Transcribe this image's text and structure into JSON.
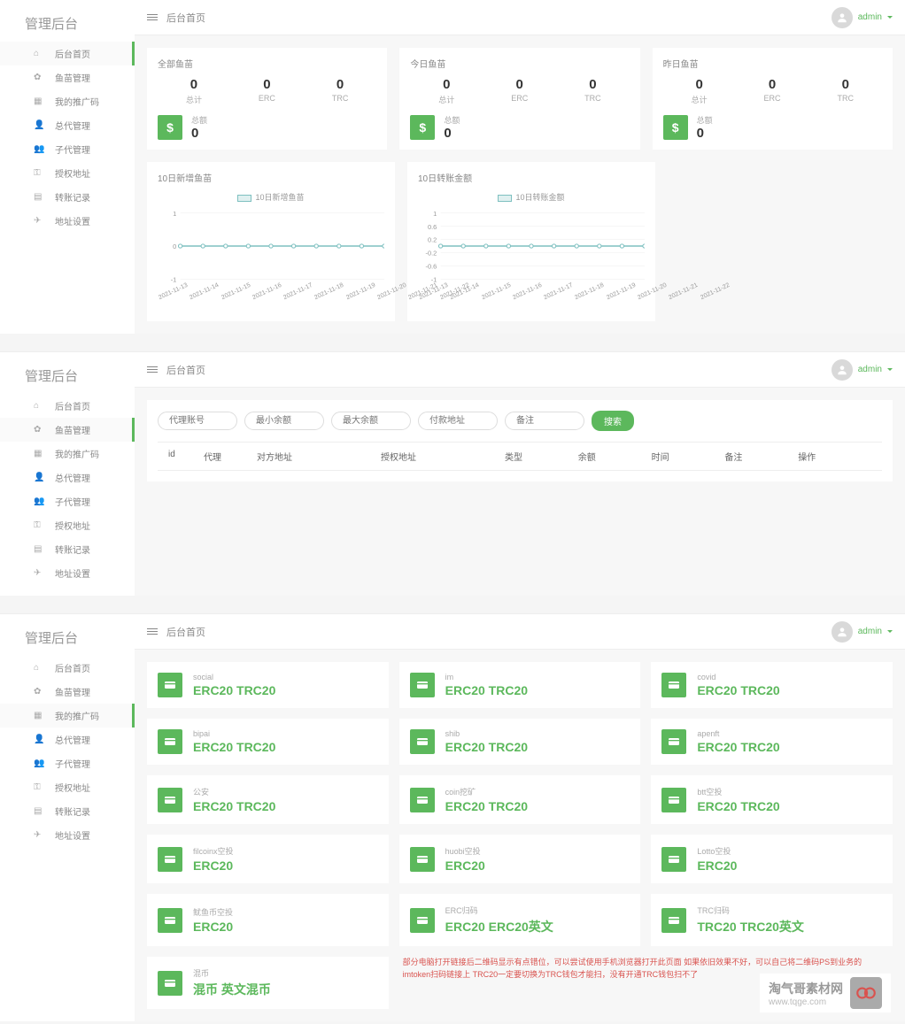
{
  "brand": "管理后台",
  "topbar": {
    "title": "后台首页",
    "user": "admin"
  },
  "sidebar": {
    "items": [
      {
        "label": "后台首页"
      },
      {
        "label": "鱼苗管理"
      },
      {
        "label": "我的推广码"
      },
      {
        "label": "总代管理"
      },
      {
        "label": "子代管理"
      },
      {
        "label": "授权地址"
      },
      {
        "label": "转账记录"
      },
      {
        "label": "地址设置"
      }
    ]
  },
  "stats": [
    {
      "title": "全部鱼苗",
      "cols": [
        {
          "val": "0",
          "label": "总计"
        },
        {
          "val": "0",
          "label": "ERC"
        },
        {
          "val": "0",
          "label": "TRC"
        }
      ],
      "total_label": "总额",
      "total_val": "0"
    },
    {
      "title": "今日鱼苗",
      "cols": [
        {
          "val": "0",
          "label": "总计"
        },
        {
          "val": "0",
          "label": "ERC"
        },
        {
          "val": "0",
          "label": "TRC"
        }
      ],
      "total_label": "总额",
      "total_val": "0"
    },
    {
      "title": "昨日鱼苗",
      "cols": [
        {
          "val": "0",
          "label": "总计"
        },
        {
          "val": "0",
          "label": "ERC"
        },
        {
          "val": "0",
          "label": "TRC"
        }
      ],
      "total_label": "总额",
      "total_val": "0"
    }
  ],
  "chart_data": [
    {
      "type": "line",
      "title": "10日新增鱼苗",
      "legend": "10日新增鱼苗",
      "categories": [
        "2021-11-13",
        "2021-11-14",
        "2021-11-15",
        "2021-11-16",
        "2021-11-17",
        "2021-11-18",
        "2021-11-19",
        "2021-11-20",
        "2021-11-21",
        "2021-11-22"
      ],
      "values": [
        0,
        0,
        0,
        0,
        0,
        0,
        0,
        0,
        0,
        0
      ],
      "ylim": [
        -1,
        1
      ],
      "yticks": [
        -1,
        0,
        1
      ]
    },
    {
      "type": "line",
      "title": "10日转账金额",
      "legend": "10日转账金额",
      "categories": [
        "2021-11-13",
        "2021-11-14",
        "2021-11-15",
        "2021-11-16",
        "2021-11-17",
        "2021-11-18",
        "2021-11-19",
        "2021-11-20",
        "2021-11-21",
        "2021-11-22"
      ],
      "values": [
        0,
        0,
        0,
        0,
        0,
        0,
        0,
        0,
        0,
        0
      ],
      "ylim": [
        -1.0,
        1.0
      ],
      "yticks": [
        -1.0,
        -0.6,
        -0.2,
        0.2,
        0.6,
        1.0
      ]
    }
  ],
  "search": {
    "placeholders": [
      "代理账号",
      "最小余额",
      "最大余额",
      "付款地址",
      "备注"
    ],
    "button": "搜索"
  },
  "table": {
    "headers": [
      "id",
      "代理",
      "对方地址",
      "授权地址",
      "类型",
      "余额",
      "时间",
      "备注",
      "操作"
    ]
  },
  "promo_cards": [
    {
      "name": "social",
      "code": "ERC20 TRC20"
    },
    {
      "name": "im",
      "code": "ERC20 TRC20"
    },
    {
      "name": "covid",
      "code": "ERC20 TRC20"
    },
    {
      "name": "bipai",
      "code": "ERC20 TRC20"
    },
    {
      "name": "shib",
      "code": "ERC20 TRC20"
    },
    {
      "name": "apenft",
      "code": "ERC20 TRC20"
    },
    {
      "name": "公安",
      "code": "ERC20 TRC20"
    },
    {
      "name": "coin挖矿",
      "code": "ERC20 TRC20"
    },
    {
      "name": "btt空投",
      "code": "ERC20 TRC20"
    },
    {
      "name": "filcoinx空投",
      "code": "ERC20"
    },
    {
      "name": "huobi空投",
      "code": "ERC20"
    },
    {
      "name": "Lotto空投",
      "code": "ERC20"
    },
    {
      "name": "鱿鱼币空投",
      "code": "ERC20"
    },
    {
      "name": "ERC归码",
      "code": "ERC20 ERC20英文"
    },
    {
      "name": "TRC归码",
      "code": "TRC20 TRC20英文"
    },
    {
      "name": "混币",
      "code": "混币 英文混币"
    }
  ],
  "note": "部分电脑打开链接后二维码显示有点错位，可以尝试使用手机浏览器打开此页面  如果依旧效果不好，可以自己将二维码PS到业务的imtoken扫码链接上  TRC20一定要切换为TRC钱包才能扫，没有开通TRC钱包扫不了",
  "watermark": {
    "text": "淘气哥素材网",
    "sub": "www.tqge.com"
  }
}
